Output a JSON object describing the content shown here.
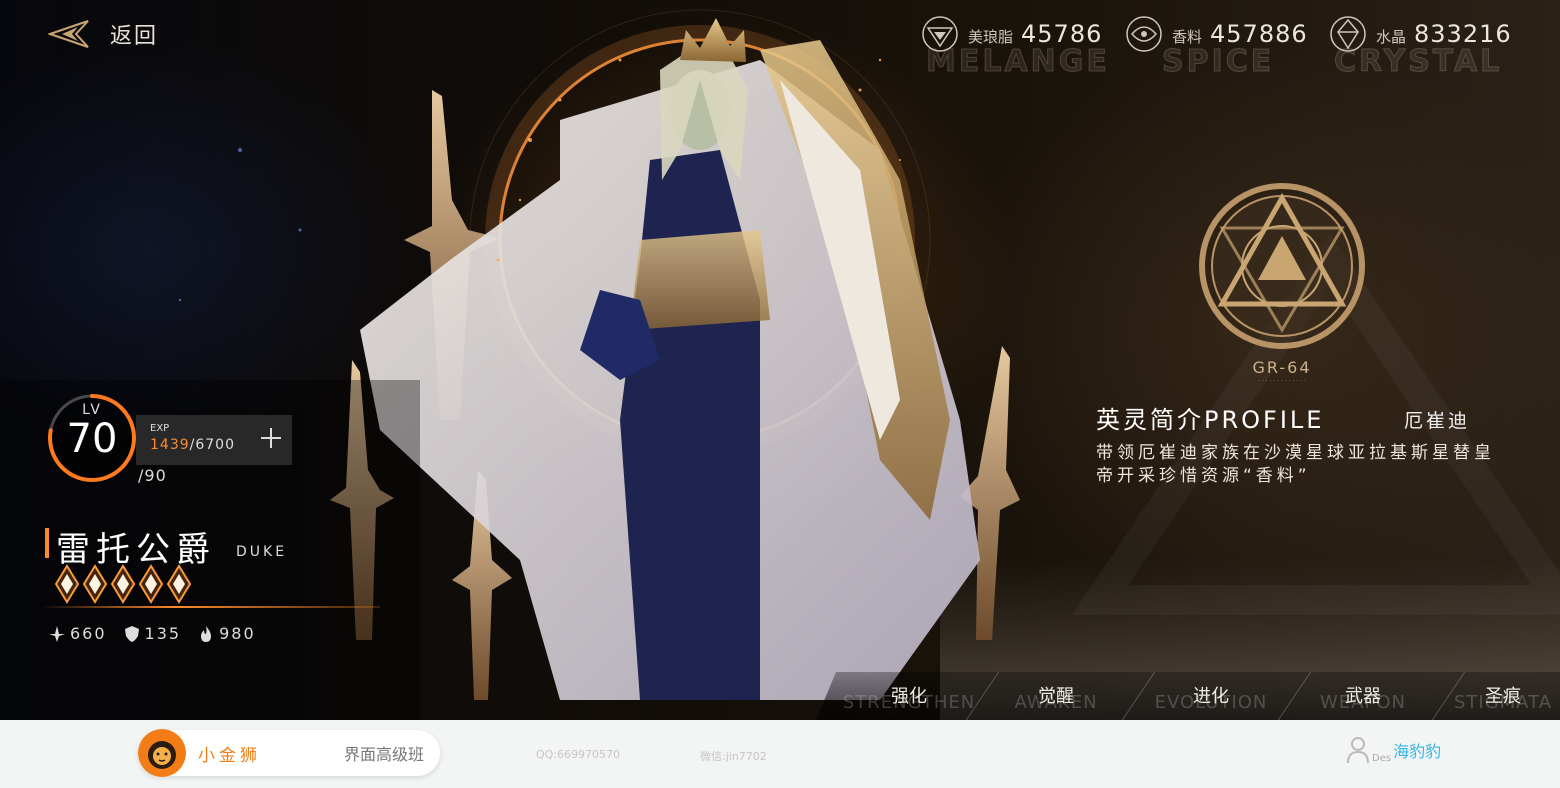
{
  "header": {
    "back_label": "返回",
    "resources": [
      {
        "name": "美琅脂",
        "value": "45786",
        "ghost": "MELANGE",
        "icon": "melange-icon"
      },
      {
        "name": "香料",
        "value": "457886",
        "ghost": "SPICE",
        "icon": "spice-icon"
      },
      {
        "name": "水晶",
        "value": "833216",
        "ghost": "CRYSTAL",
        "icon": "crystal-icon"
      }
    ]
  },
  "hero": {
    "lv_label": "LV",
    "level": "70",
    "max_level": "/90",
    "level_progress": 0.778,
    "exp_label": "EXP",
    "exp_current": "1439",
    "exp_max": "/6700",
    "name": "雷托公爵",
    "title_en": "DUKE",
    "stars": 5,
    "stats": [
      {
        "icon": "attack-icon",
        "value": "660"
      },
      {
        "icon": "shield-icon",
        "value": "135"
      },
      {
        "icon": "flame-icon",
        "value": "980"
      }
    ]
  },
  "profile": {
    "code": "GR-64",
    "title": "英灵简介PROFILE",
    "name": "厄崔迪",
    "description": "带领厄崔迪家族在沙漠星球亚拉基斯星替皇帝开采珍惜资源“香料”"
  },
  "tabs": [
    {
      "label": "强化",
      "ghost": "STRENGTHEN"
    },
    {
      "label": "觉醒",
      "ghost": "AWAKEN"
    },
    {
      "label": "进化",
      "ghost": "EVOLUTION"
    },
    {
      "label": "武器",
      "ghost": "WEAPON"
    },
    {
      "label": "圣痕",
      "ghost": "STIGMATA"
    }
  ],
  "footer": {
    "brand_name": "小金狮",
    "course": "界面高级班",
    "qq": "QQ:669970570",
    "wechat": "微信:jin7702",
    "user_des": "Des",
    "user_name": "海豹豹"
  },
  "colors": {
    "accent": "#ff8a2a",
    "gold": "#cbb28a",
    "link": "#35b6e8"
  }
}
